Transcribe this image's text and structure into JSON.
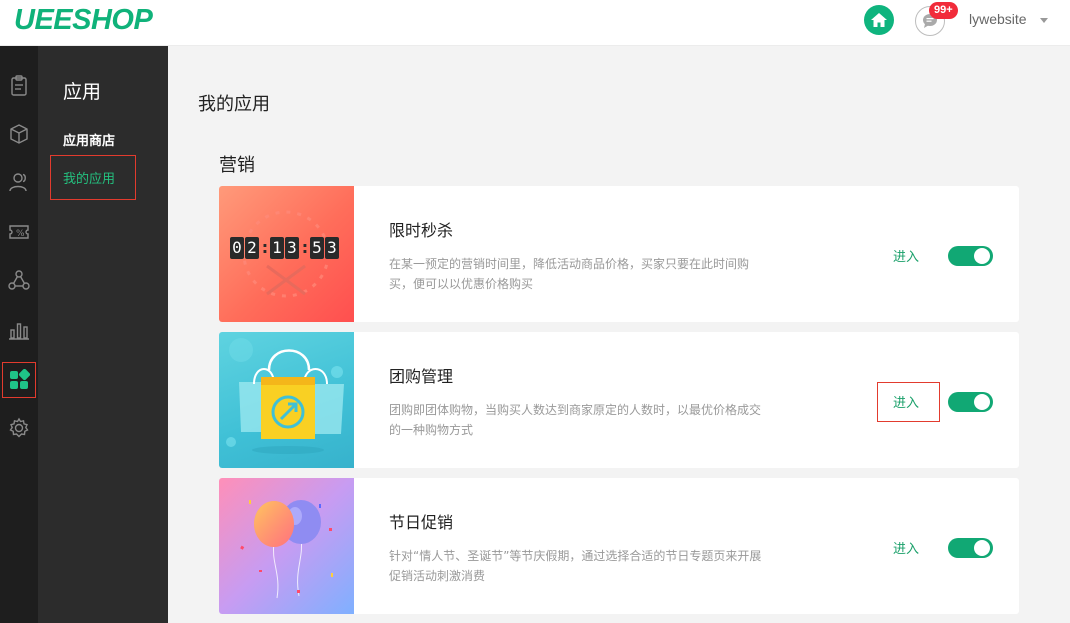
{
  "header": {
    "logo": "UEESHOP",
    "badge": "99+",
    "username": "lywebsite"
  },
  "rail": {
    "items": [
      {
        "icon": "clipboard-icon"
      },
      {
        "icon": "box-icon"
      },
      {
        "icon": "users-icon"
      },
      {
        "icon": "coupon-icon"
      },
      {
        "icon": "network-icon"
      },
      {
        "icon": "bar-chart-icon"
      },
      {
        "icon": "apps-icon",
        "active": true
      },
      {
        "icon": "gear-icon"
      }
    ]
  },
  "sidebar": {
    "title": "应用",
    "items": [
      {
        "label": "应用商店"
      },
      {
        "label": "我的应用",
        "active": true
      }
    ]
  },
  "main": {
    "page_title": "我的应用",
    "section_title": "营销",
    "apps": [
      {
        "name": "限时秒杀",
        "desc": "在某一预定的营销时间里，降低活动商品价格，买家只要在此时间购买，便可以以优惠价格购买",
        "enter": "进入",
        "enabled": true,
        "clock": [
          "0",
          "2",
          "1",
          "3",
          "5",
          "3"
        ]
      },
      {
        "name": "团购管理",
        "desc": "团购即团体购物，当购买人数达到商家原定的人数时，以最优价格成交的一种购物方式",
        "enter": "进入",
        "enabled": true
      },
      {
        "name": "节日促销",
        "desc": "针对“情人节、圣诞节”等节庆假期，通过选择合适的节日专题页来开展促销活动刺激消费",
        "enter": "进入",
        "enabled": true
      }
    ]
  },
  "colors": {
    "brand": "#10b27a",
    "rail_bg": "#1e1e1e",
    "sidebar_bg": "#2c2c2c",
    "toggle_on": "#11a874",
    "highlight": "#e23b2e"
  }
}
